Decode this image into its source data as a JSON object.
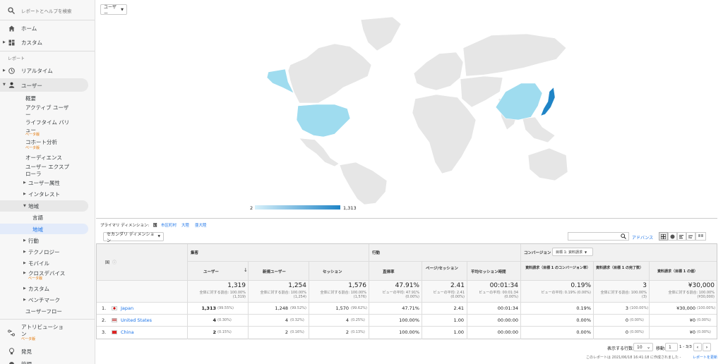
{
  "sidebar": {
    "search_placeholder": "レポートとヘルプを検索",
    "home": "ホーム",
    "custom": "カスタム",
    "section_reports": "レポート",
    "realtime": "リアルタイム",
    "users": "ユーザー",
    "overview": "概要",
    "active_users_1": "アクティブ ユーザ",
    "active_users_2": "ー",
    "lifetime_1": "ライフタイム バリ",
    "lifetime_2": "ュー",
    "beta1": "ベータ版",
    "cohort": "コホート分析",
    "beta2": "ベータ版",
    "audience": "オーディエンス",
    "explorer_1": "ユーザー エクスプ",
    "explorer_2": "ローラ",
    "demographics": "ユーザー属性",
    "interests": "インタレスト",
    "geo": "地域",
    "language": "言語",
    "location": "地域",
    "behavior": "行動",
    "technology": "テクノロジー",
    "mobile": "モバイル",
    "crossdevice": "クロスデバイス",
    "beta3": "ベータ版",
    "custom2": "カスタム",
    "benchmark": "ベンチマーク",
    "userflow": "ユーザーフロー",
    "attribution_1": "アトリビューショ",
    "attribution_2": "ン",
    "beta4": "ベータ版",
    "discover": "発見",
    "admin": "管理"
  },
  "top": {
    "metric_select": "ユーザー"
  },
  "map": {
    "legend_min": "2",
    "legend_max": "1,313"
  },
  "dimensions": {
    "label": "プライマリ ディメンション:",
    "active": "国",
    "opt1": "市区町村",
    "opt2": "大陸",
    "opt3": "亜大陸"
  },
  "secondary": {
    "label": "セカンダリ ディメンション"
  },
  "search": {
    "advanced": "アドバンス"
  },
  "table": {
    "group_acq": "集客",
    "group_beh": "行動",
    "group_conv": "コンバージョン",
    "goal_select": "目標 1: 資料請求",
    "col_country": "国",
    "cols": [
      "ユーザー",
      "新規ユーザー",
      "セッション",
      "直帰率",
      "ページ/セッション",
      "平均セッション時間",
      "資料請求（目標 1 のコンバージョン率）",
      "資料請求（目標 1 の完了数）",
      "資料請求（目標 1 の値）"
    ],
    "totals": [
      {
        "v": "1,319",
        "s1": "全体に対する割合: 100.00%",
        "s2": "(1,319)"
      },
      {
        "v": "1,254",
        "s1": "全体に対する割合: 100.00%",
        "s2": "(1,254)"
      },
      {
        "v": "1,576",
        "s1": "全体に対する割合: 100.00%",
        "s2": "(1,576)"
      },
      {
        "v": "47.91%",
        "s1": "ビューの平均: 47.91%",
        "s2": "(0.00%)"
      },
      {
        "v": "2.41",
        "s1": "ビューの平均: 2.41",
        "s2": "(0.00%)"
      },
      {
        "v": "00:01:34",
        "s1": "ビューの平均: 00:01:34",
        "s2": "(0.00%)"
      },
      {
        "v": "0.19%",
        "s1": "ビューの平均: 0.19% (0.00%)",
        "s2": ""
      },
      {
        "v": "3",
        "s1": "全体に対する割合: 100.00%",
        "s2": "(3)"
      },
      {
        "v": "¥30,000",
        "s1": "全体に対する割合: 100.00%",
        "s2": "(¥30,000)"
      }
    ],
    "rows": [
      {
        "n": "1.",
        "country": "Japan",
        "users": "1,313",
        "users_p": "(99.55%)",
        "new": "1,248",
        "new_p": "(99.52%)",
        "sess": "1,570",
        "sess_p": "(99.62%)",
        "bounce": "47.71%",
        "pps": "2.41",
        "dur": "00:01:34",
        "cr": "0.19%",
        "comp": "3",
        "comp_p": "(100.00%)",
        "val": "¥30,000",
        "val_p": "(100.00%)"
      },
      {
        "n": "2.",
        "country": "United States",
        "users": "4",
        "users_p": "(0.30%)",
        "new": "4",
        "new_p": "(0.32%)",
        "sess": "4",
        "sess_p": "(0.25%)",
        "bounce": "100.00%",
        "pps": "1.00",
        "dur": "00:00:00",
        "cr": "0.00%",
        "comp": "0",
        "comp_p": "(0.00%)",
        "val": "¥0",
        "val_p": "(0.00%)"
      },
      {
        "n": "3.",
        "country": "China",
        "users": "2",
        "users_p": "(0.15%)",
        "new": "2",
        "new_p": "(0.16%)",
        "sess": "2",
        "sess_p": "(0.13%)",
        "bounce": "100.00%",
        "pps": "1.00",
        "dur": "00:00:00",
        "cr": "0.00%",
        "comp": "0",
        "comp_p": "(0.00%)",
        "val": "¥0",
        "val_p": "(0.00%)"
      }
    ]
  },
  "pager": {
    "rows_label": "表示する行数:",
    "rows_value": "10",
    "goto_label": "移動:",
    "goto_value": "1",
    "range": "1 - 3/3"
  },
  "footer": {
    "text": "このレポートは 2021/06/18 16:41:18 に作成されました -",
    "refresh": "レポートを更新"
  }
}
